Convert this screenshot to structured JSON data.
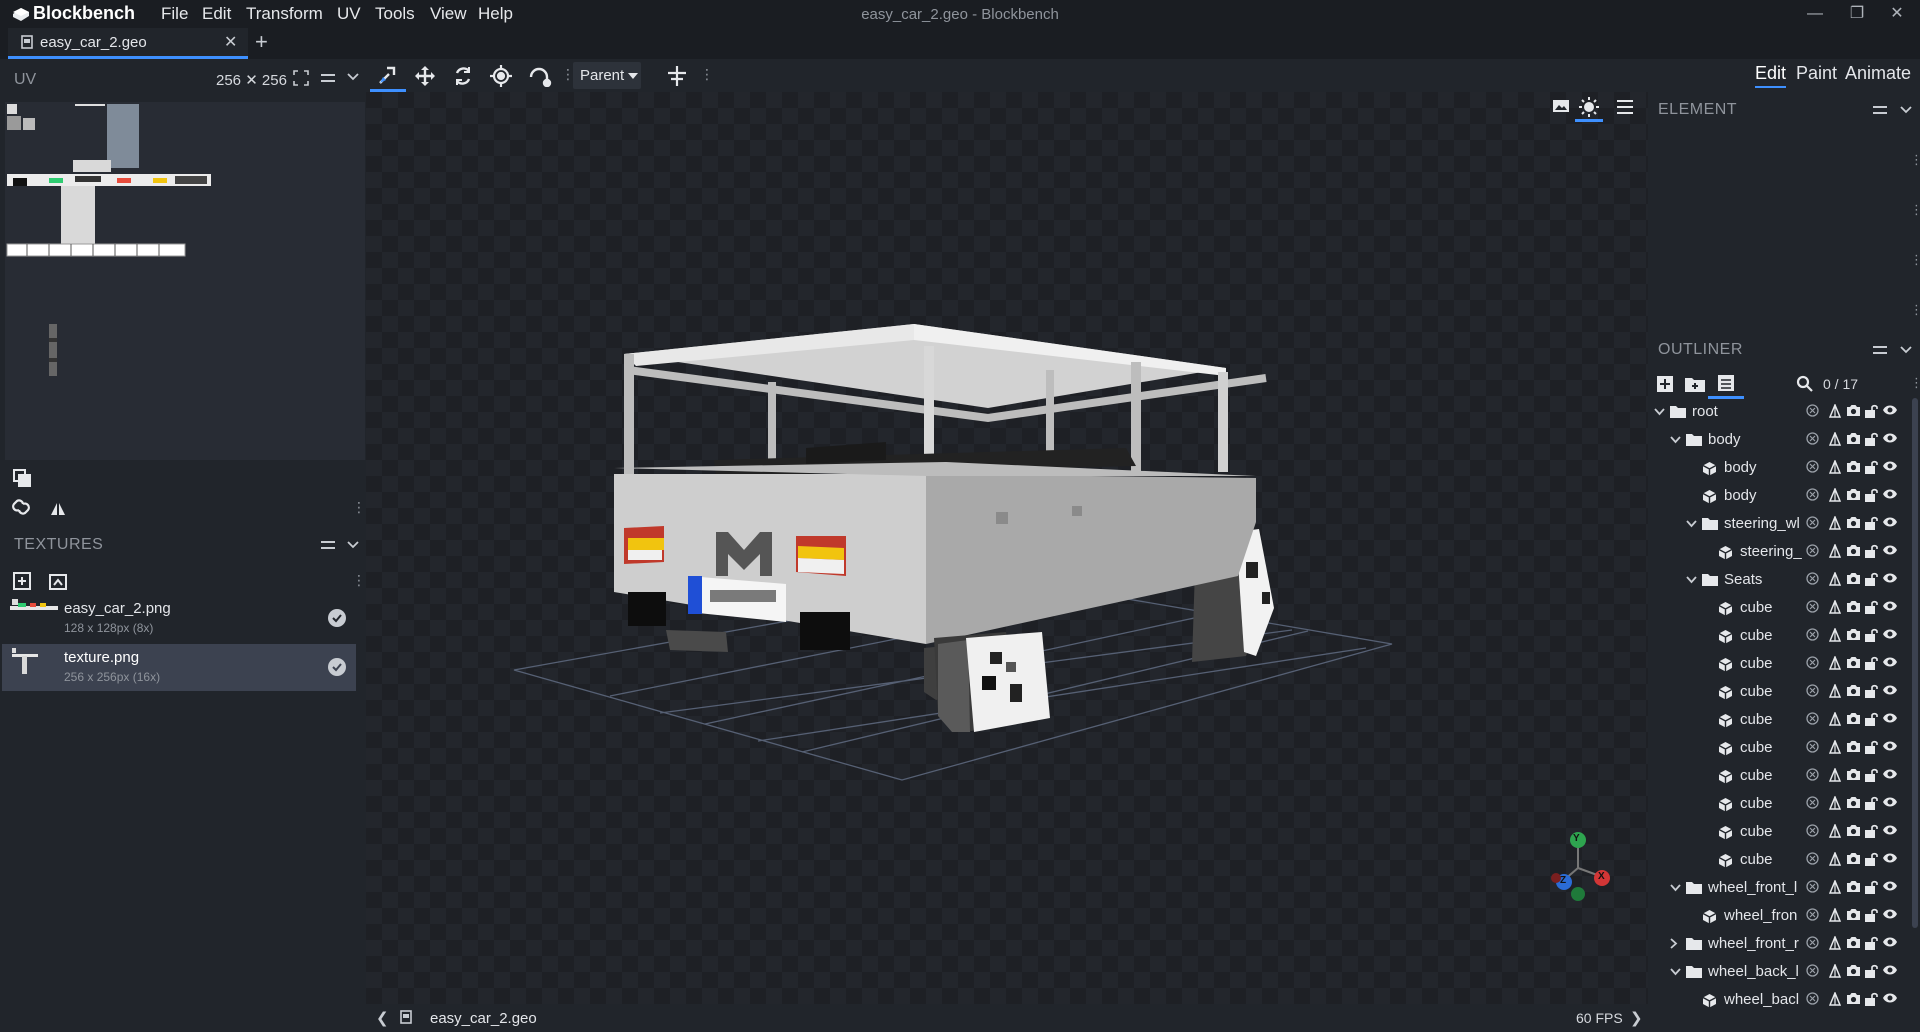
{
  "app": {
    "name": "Blockbench",
    "window_title": "easy_car_2.geo - Blockbench"
  },
  "menu": [
    "File",
    "Edit",
    "Transform",
    "UV",
    "Tools",
    "View",
    "Help"
  ],
  "tabs": [
    {
      "label": "easy_car_2.geo"
    }
  ],
  "uv_panel": {
    "title": "UV",
    "size_label": "256 ✕ 256"
  },
  "toolbar": {
    "pivot_mode": "Parent"
  },
  "modes": {
    "edit": "Edit",
    "paint": "Paint",
    "animate": "Animate"
  },
  "textures": {
    "title": "TEXTURES",
    "items": [
      {
        "name": "easy_car_2.png",
        "info": "128 x 128px (8x)"
      },
      {
        "name": "texture.png",
        "info": "256 x 256px (16x)"
      }
    ]
  },
  "element_panel": {
    "title": "ELEMENT"
  },
  "outliner": {
    "title": "OUTLINER",
    "count": "0 / 17",
    "rows": [
      {
        "label": "root",
        "type": "group",
        "arrow": "open"
      },
      {
        "label": "body",
        "type": "group",
        "arrow": "open"
      },
      {
        "label": "body",
        "type": "cube",
        "arrow": ""
      },
      {
        "label": "body",
        "type": "cube",
        "arrow": ""
      },
      {
        "label": "steering_wl",
        "type": "group",
        "arrow": "open"
      },
      {
        "label": "steering_",
        "type": "cube",
        "arrow": ""
      },
      {
        "label": "Seats",
        "type": "group",
        "arrow": "open"
      },
      {
        "label": "cube",
        "type": "cube",
        "arrow": ""
      },
      {
        "label": "cube",
        "type": "cube",
        "arrow": ""
      },
      {
        "label": "cube",
        "type": "cube",
        "arrow": ""
      },
      {
        "label": "cube",
        "type": "cube",
        "arrow": ""
      },
      {
        "label": "cube",
        "type": "cube",
        "arrow": ""
      },
      {
        "label": "cube",
        "type": "cube",
        "arrow": ""
      },
      {
        "label": "cube",
        "type": "cube",
        "arrow": ""
      },
      {
        "label": "cube",
        "type": "cube",
        "arrow": ""
      },
      {
        "label": "cube",
        "type": "cube",
        "arrow": ""
      },
      {
        "label": "cube",
        "type": "cube",
        "arrow": ""
      },
      {
        "label": "wheel_front_l",
        "type": "group",
        "arrow": "open"
      },
      {
        "label": "wheel_fron",
        "type": "cube",
        "arrow": ""
      },
      {
        "label": "wheel_front_r",
        "type": "group",
        "arrow": "closed"
      },
      {
        "label": "wheel_back_l",
        "type": "group",
        "arrow": "open"
      },
      {
        "label": "wheel_bacl",
        "type": "cube",
        "arrow": ""
      }
    ]
  },
  "status": {
    "file": "easy_car_2.geo",
    "fps": "60 FPS"
  },
  "gizmo": {
    "x": "X",
    "y": "Y",
    "z": "Z"
  },
  "colors": {
    "accent": "#3e90ff",
    "panel": "#21252b",
    "header": "#1a1d22"
  },
  "icons": [
    "blockbench-logo-icon",
    "plus-icon",
    "move-icon",
    "rotate-icon",
    "pivot-icon",
    "eye-icon",
    "lock-icon",
    "camera-icon",
    "search-icon",
    "folder-icon",
    "cube-icon"
  ]
}
